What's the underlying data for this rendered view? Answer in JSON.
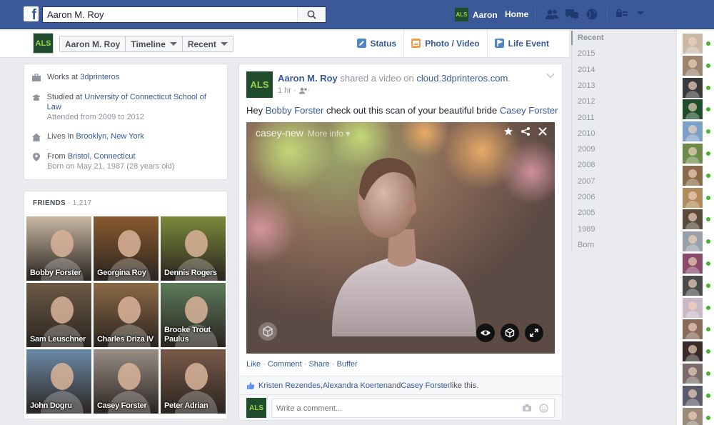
{
  "topbar": {
    "logo": "f",
    "search_value": "Aaron M. Roy",
    "user_name": "Aaron",
    "user_avatar_text": "ALS",
    "home_label": "Home"
  },
  "subnav": {
    "avatar_text": "ALS",
    "profile_label": "Aaron M. Roy",
    "timeline_label": "Timeline",
    "recent_label": "Recent",
    "status_label": "Status",
    "photo_label": "Photo / Video",
    "life_event_label": "Life Event"
  },
  "about": {
    "works_prefix": "Works at ",
    "works_at": "3dprinteros",
    "studied_prefix": "Studied at ",
    "studied_at": "University of Connecticut School of Law",
    "attended": "Attended from 2009 to 2012",
    "lives_prefix": "Lives in ",
    "lives_in": "Brooklyn, New York",
    "from_prefix": "From ",
    "from": "Bristol, Connecticut",
    "born": "Born on May 21, 1987 (28 years old)"
  },
  "friends": {
    "heading": "FRIENDS",
    "count": " · 1,217",
    "items": [
      {
        "name": "Bobby Forster",
        "color": "#c9b7a3"
      },
      {
        "name": "Georgina Roy",
        "color": "#8a5a2e"
      },
      {
        "name": "Dennis Rogers",
        "color": "#7a8a3a"
      },
      {
        "name": "Sam Leuschner",
        "color": "#6d5a45"
      },
      {
        "name": "Charles Driza IV",
        "color": "#8c6a46"
      },
      {
        "name": "Brooke Trout Paulus",
        "color": "#5c7a5a"
      },
      {
        "name": "John Dogru",
        "color": "#6b8aa8"
      },
      {
        "name": "Casey Forster",
        "color": "#9a8e86"
      },
      {
        "name": "Peter Adrian",
        "color": "#7a5a4a"
      }
    ]
  },
  "post": {
    "avatar_text": "ALS",
    "author": "Aaron M. Roy",
    "action": " shared a video on ",
    "site": "cloud.3dprinteros.com",
    "period": ".",
    "time": "1 hr · ",
    "text_prefix": "Hey ",
    "mention1": "Bobby Forster",
    "text_middle": " check out this scan of your beautiful bride ",
    "mention2": "Casey Forster",
    "media_title": "casey-new",
    "media_more": "More info ▾",
    "action_like": "Like",
    "action_comment": "Comment",
    "action_share": "Share",
    "action_buffer": "Buffer",
    "sep": " · ",
    "liker1": "Kristen Rezendes",
    "liker_sep": ", ",
    "liker2": "Alexandra Koerten",
    "liker_and": " and ",
    "liker3": "Casey Forster",
    "likes_suffix": " like this.",
    "comment_placeholder": "Write a comment..."
  },
  "scrubber": {
    "items": [
      "Recent",
      "2015",
      "2014",
      "2013",
      "2012",
      "2011",
      "2010",
      "2009",
      "2008",
      "2007",
      "2006",
      "2005",
      "1989",
      "Born"
    ]
  },
  "chat": {
    "avatars": [
      "#cbb9a8",
      "#9c8570",
      "#3a3a3a",
      "#1f4c2c",
      "#7da0c8",
      "#6d8a4a",
      "#8a6a4a",
      "#b08a5a",
      "#5a4a3a",
      "#9aa0a8",
      "#8a4a6a",
      "#4a4a4a",
      "#c8b8c8",
      "#8a6a5a",
      "#3a2a2a",
      "#7a6a6a",
      "#5a5a6a",
      "#9a8a7a"
    ]
  },
  "colors": {
    "brand": "#3b5998",
    "link": "#365899",
    "online": "#42b72a"
  }
}
